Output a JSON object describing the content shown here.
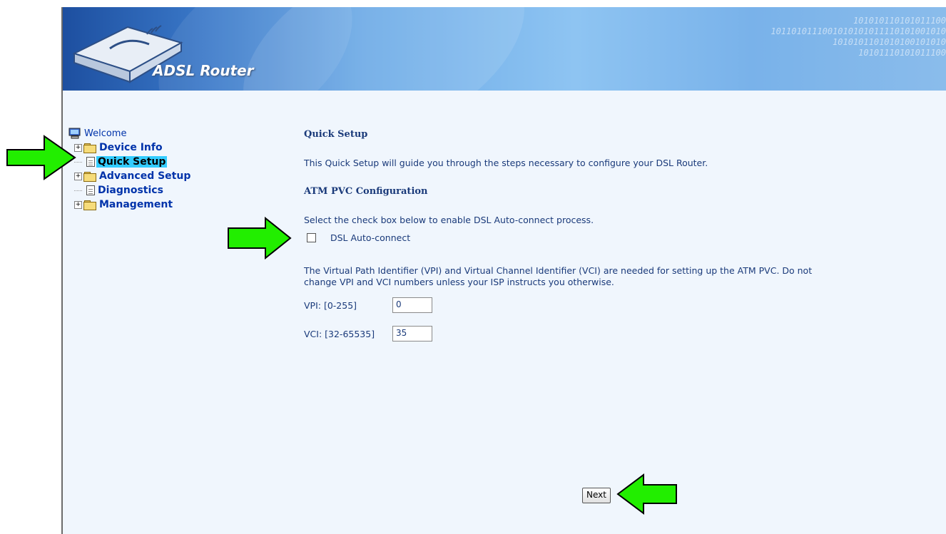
{
  "header": {
    "top_strip_text": "",
    "title": "ADSL Router",
    "binary_rows": [
      "101010110101011100",
      "1011010111001010101011110101001010",
      "1010101101010100101010",
      "10101110101011100"
    ]
  },
  "menu": {
    "welcome": "Welcome",
    "items": [
      {
        "label": "Device Info",
        "type": "folder",
        "expandable": true
      },
      {
        "label": "Quick Setup",
        "type": "page",
        "selected": true
      },
      {
        "label": "Advanced Setup",
        "type": "folder",
        "expandable": true
      },
      {
        "label": "Diagnostics",
        "type": "page"
      },
      {
        "label": "Management",
        "type": "folder",
        "expandable": true
      }
    ]
  },
  "main": {
    "title": "Quick Setup",
    "intro": "This Quick Setup will guide you through the steps necessary to configure your DSL Router.",
    "atm_title": "ATM PVC Configuration",
    "select_text": "Select the check box below to enable DSL Auto-connect process.",
    "auto_connect_label": "DSL Auto-connect",
    "auto_connect_checked": false,
    "vpi_vci_text_1": "The Virtual Path Identifier (VPI) and Virtual Channel Identifier (VCI) are needed for setting up the ATM PVC. Do not",
    "vpi_vci_text_2": "change VPI and VCI numbers unless your ISP instructs you otherwise.",
    "vpi_label": "VPI: [0-255]",
    "vpi_value": "0",
    "vci_label": "VCI: [32-65535]",
    "vci_value": "35",
    "next_label": "Next"
  },
  "colors": {
    "arrow_fill": "#22ee00",
    "selected_menu_bg": "#33ccff",
    "content_bg": "#f0f6fd",
    "link_blue": "#0033aa"
  }
}
